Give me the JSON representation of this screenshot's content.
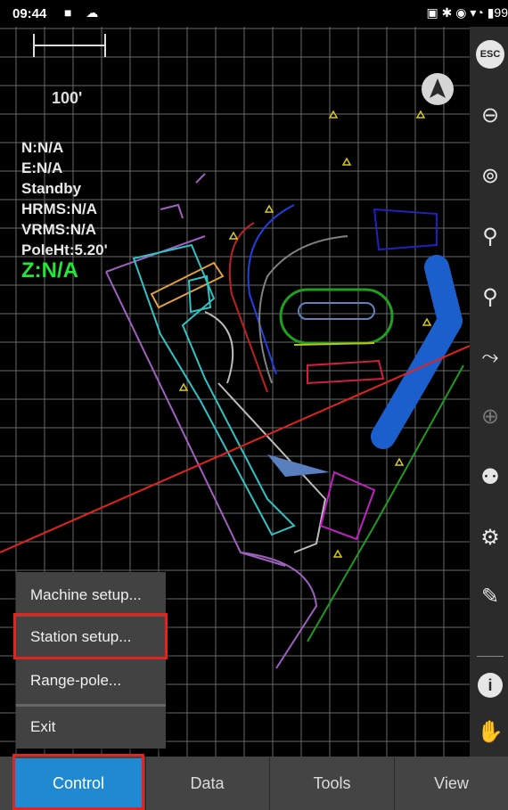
{
  "status_bar": {
    "time": "09:44",
    "battery": "99"
  },
  "map": {
    "scale_label": "100'",
    "readouts": {
      "north": "N:N/A",
      "east": "E:N/A",
      "state": "Standby",
      "hrms": "HRMS:N/A",
      "vrms": "VRMS:N/A",
      "pole_height": "PoleHt:5.20'",
      "z": "Z:N/A"
    }
  },
  "toolbar": {
    "esc_label": "ESC",
    "info_label": "i",
    "icons": [
      "esc-icon",
      "zoom-extents-icon",
      "zoom-window-icon",
      "stake-point-icon",
      "stake-alignment-icon",
      "route-icon",
      "layer-icon",
      "walk-icon",
      "measure-icon",
      "edit-icon",
      "info-icon",
      "pan-hand-icon"
    ]
  },
  "menu": {
    "items": [
      "Machine setup...",
      "Station setup...",
      "Range-pole...",
      "Exit"
    ]
  },
  "tabs": [
    "Control",
    "Data",
    "Tools",
    "View"
  ],
  "colors": {
    "tab_active": "#1f8ad2",
    "highlight": "#e3231d",
    "z_readout": "#24e53a"
  }
}
